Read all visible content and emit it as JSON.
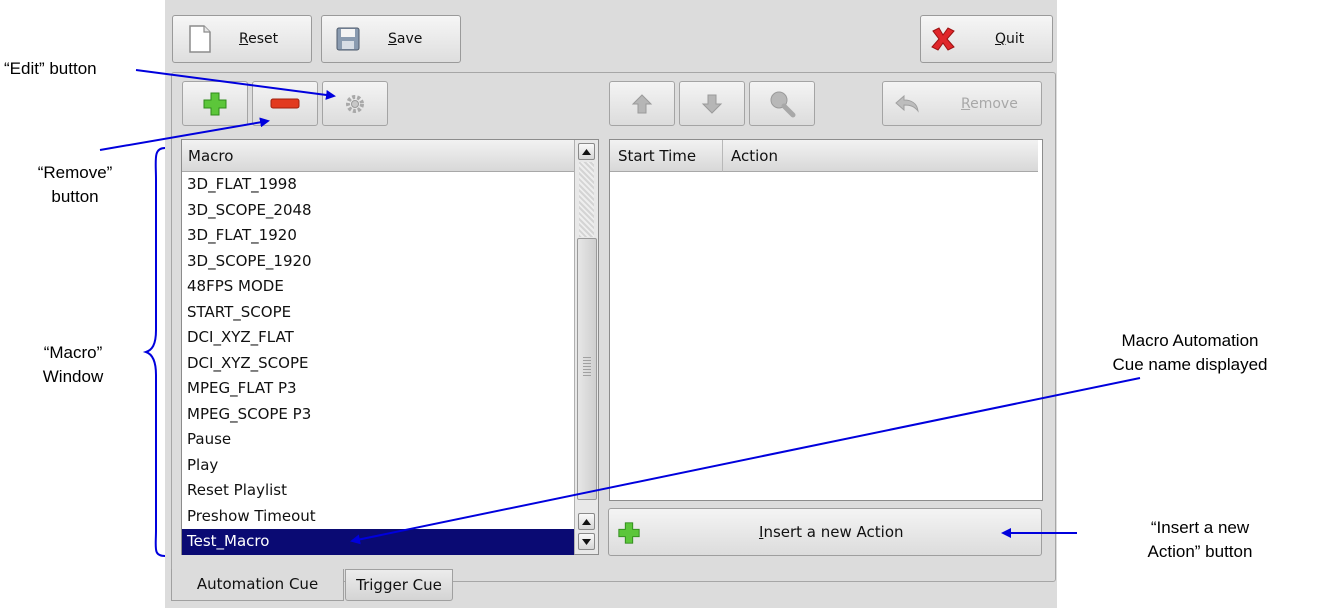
{
  "toolbar": {
    "reset_label": "Reset",
    "save_label": "Save",
    "quit_label": "Quit",
    "remove_label": "Remove"
  },
  "macro_list": {
    "header": "Macro",
    "items": [
      "3D_FLAT_1998",
      "3D_SCOPE_2048",
      "3D_FLAT_1920",
      "3D_SCOPE_1920",
      "48FPS MODE",
      "START_SCOPE",
      "DCI_XYZ_FLAT",
      "DCI_XYZ_SCOPE",
      "MPEG_FLAT P3",
      "MPEG_SCOPE P3",
      "Pause",
      "Play",
      "Reset Playlist",
      "Preshow Timeout",
      "Test_Macro"
    ],
    "selected": "Test_Macro"
  },
  "action_table": {
    "columns": [
      "Start Time",
      "Action"
    ]
  },
  "insert_button": {
    "label": "Insert a new Action"
  },
  "tabs": [
    {
      "label": "Automation Cue",
      "active": true
    },
    {
      "label": "Trigger Cue",
      "active": false
    }
  ],
  "annotations": {
    "edit_button": "“Edit” button",
    "remove_button_1": "“Remove”",
    "remove_button_2": "button",
    "macro_window_1": "“Macro”",
    "macro_window_2": "Window",
    "cue_name_1": "Macro Automation",
    "cue_name_2": "Cue name displayed",
    "insert_action_1": "“Insert a new",
    "insert_action_2": "Action” button"
  },
  "colors": {
    "selection": "#0a0a73",
    "annotation_line": "#0000dd",
    "add_icon": "#5cc63a",
    "remove_icon": "#e23a1f",
    "quit_icon": "#e0262a"
  },
  "icons": {
    "reset": "document-icon",
    "save": "floppy-disk-icon",
    "quit": "red-x-icon",
    "add": "plus-icon",
    "remove": "minus-icon",
    "edit": "gear-icon",
    "up": "arrow-up-icon",
    "down": "arrow-down-icon",
    "find": "search-icon",
    "undo": "curved-arrow-icon"
  }
}
